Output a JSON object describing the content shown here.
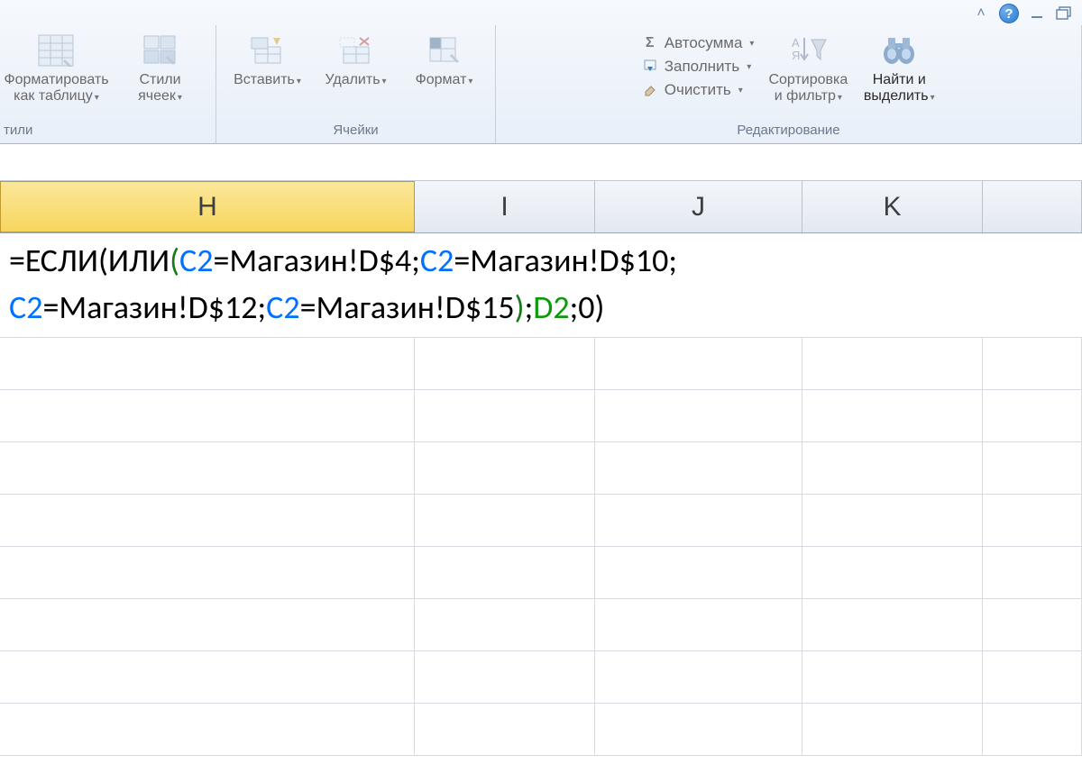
{
  "titlebar": {
    "help": "?",
    "caret": "˄"
  },
  "ribbon": {
    "styles_group": {
      "label": "тили",
      "format_table": "Форматировать",
      "format_table2": "как таблицу",
      "cell_styles": "Стили",
      "cell_styles2": "ячеек"
    },
    "cells_group": {
      "label": "Ячейки",
      "insert": "Вставить",
      "delete": "Удалить",
      "format": "Формат"
    },
    "editing_group": {
      "label": "Редактирование",
      "autosum_sigma": "Σ",
      "autosum": "Автосумма",
      "fill": "Заполнить",
      "clear": "Очистить",
      "sort": "Сортировка",
      "sort2": "и фильтр",
      "find": "Найти и",
      "find2": "выделить"
    }
  },
  "columns": {
    "H": "H",
    "I": "I",
    "J": "J",
    "K": "K"
  },
  "formula": {
    "p01": "=ЕСЛИ",
    "p02": "(",
    "p03": "ИЛИ",
    "p04": "(",
    "p05": "C2",
    "p06": "=Магазин!D$4;",
    "p07": "C2",
    "p08": "=Магазин!D$10;",
    "p09": "C2",
    "p10": "=Магазин!D$12;",
    "p11": "C2",
    "p12": "=Магазин!D$15",
    "p13": ")",
    "p14": ";",
    "p15": "D2",
    "p16": ";0)"
  },
  "col_widths": {
    "first": 460,
    "I": 200,
    "J": 230,
    "K": 200,
    "last": 110
  }
}
